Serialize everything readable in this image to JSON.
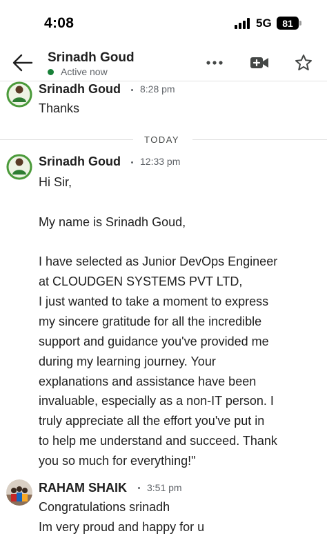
{
  "status_bar": {
    "time": "4:08",
    "network": "5G",
    "battery": "81"
  },
  "header": {
    "contact_name": "Srinadh Goud",
    "presence": "Active now",
    "presence_color": "#188038"
  },
  "icons": {
    "back": "arrow-left-icon",
    "more": "more-horizontal-icon",
    "video": "video-call-icon",
    "star": "star-outline-icon"
  },
  "divider": {
    "label": "TODAY"
  },
  "messages": [
    {
      "sender": "Srinadh Goud",
      "time": "8:28 pm",
      "lines": [
        "Thanks"
      ]
    },
    {
      "sender": "Srinadh Goud",
      "time": "12:33 pm",
      "lines": [
        "Hi Sir,",
        "",
        "My name is Srinadh Goud,",
        "",
        "I have selected as Junior DevOps Engineer",
        "at CLOUDGEN SYSTEMS PVT LTD,",
        "I just wanted to take a moment to express",
        "my sincere gratitude for all the incredible",
        "support and guidance you've provided me",
        "during my learning journey. Your",
        "explanations and assistance have been",
        "invaluable, especially as a non-IT person. I",
        "truly appreciate all the effort you've put in",
        "to help me understand and succeed. Thank",
        "you so much for everything!\""
      ]
    },
    {
      "sender": "RAHAM SHAIK",
      "time": "3:51 pm",
      "lines": [
        "Congratulations srinadh",
        "Im very proud and happy for u"
      ]
    }
  ]
}
